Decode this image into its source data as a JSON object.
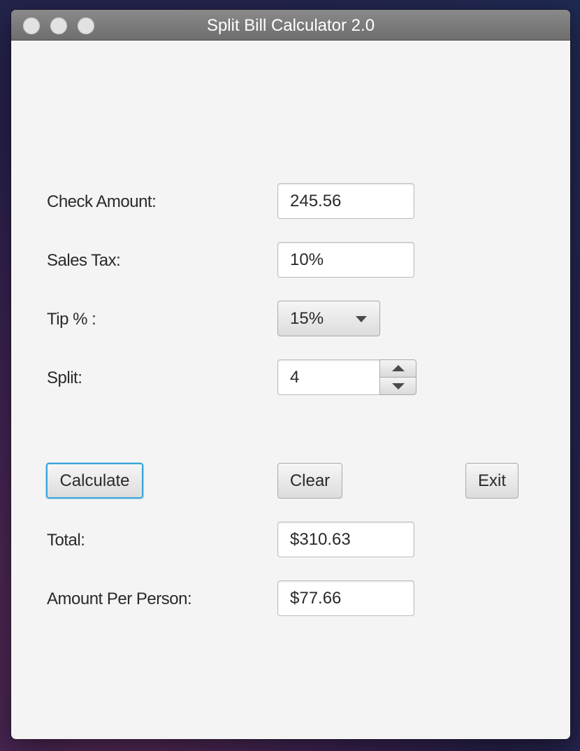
{
  "window": {
    "title": "Split Bill Calculator 2.0"
  },
  "form": {
    "check_amount_label": "Check Amount:",
    "check_amount_value": "245.56",
    "sales_tax_label": "Sales Tax:",
    "sales_tax_value": "10%",
    "tip_label": "Tip % :",
    "tip_selected": "15%",
    "split_label": "Split:",
    "split_value": "4"
  },
  "buttons": {
    "calculate": "Calculate",
    "clear": "Clear",
    "exit": "Exit"
  },
  "results": {
    "total_label": "Total:",
    "total_value": "$310.63",
    "per_person_label": "Amount Per Person:",
    "per_person_value": "$77.66"
  },
  "colors": {
    "focus_ring": "#3aa6d8",
    "window_background": "#f4f4f4",
    "titlebar": "#7a7a7a"
  },
  "icons": {
    "dropdown": "chevron-down-icon",
    "spinner_up": "arrow-up-icon",
    "spinner_down": "arrow-down-icon"
  }
}
